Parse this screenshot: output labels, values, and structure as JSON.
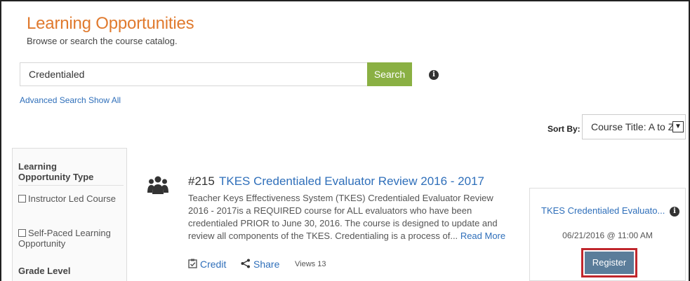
{
  "header": {
    "title": "Learning Opportunities",
    "subtitle": "Browse or search the course catalog."
  },
  "search": {
    "value": "Credentialed",
    "button_label": "Search",
    "advanced_link": "Advanced Search",
    "show_all_link": "Show All"
  },
  "sort": {
    "label": "Sort By:",
    "selected": "Course Title: A to Z"
  },
  "filters": {
    "type_heading": "Learning Opportunity Type",
    "options": [
      "Instructor Led Course",
      "Self-Paced Learning Opportunity"
    ],
    "grade_heading": "Grade Level"
  },
  "course": {
    "number": "#215",
    "title": "TKES Credentialed Evaluator Review 2016 - 2017",
    "description": "Teacher Keys Effectiveness System (TKES) Credentialed Evaluator Review 2016 - 2017is a REQUIRED course for ALL evaluators who have been credentialed PRIOR to June 30, 2016. The course is designed to update and review all components of the TKES. Credentialing is a process of...",
    "read_more": "Read More",
    "credit_label": "Credit",
    "share_label": "Share",
    "views": "Views 13"
  },
  "session": {
    "title": "TKES Credentialed Evaluato...",
    "datetime": "06/21/2016 @ 11:00 AM",
    "register_label": "Register"
  },
  "colors": {
    "title_orange": "#e07a2e",
    "link_blue": "#2f6fba",
    "search_green": "#8ab043",
    "register_blue": "#5b7d9a",
    "highlight_red": "#c0262c"
  }
}
